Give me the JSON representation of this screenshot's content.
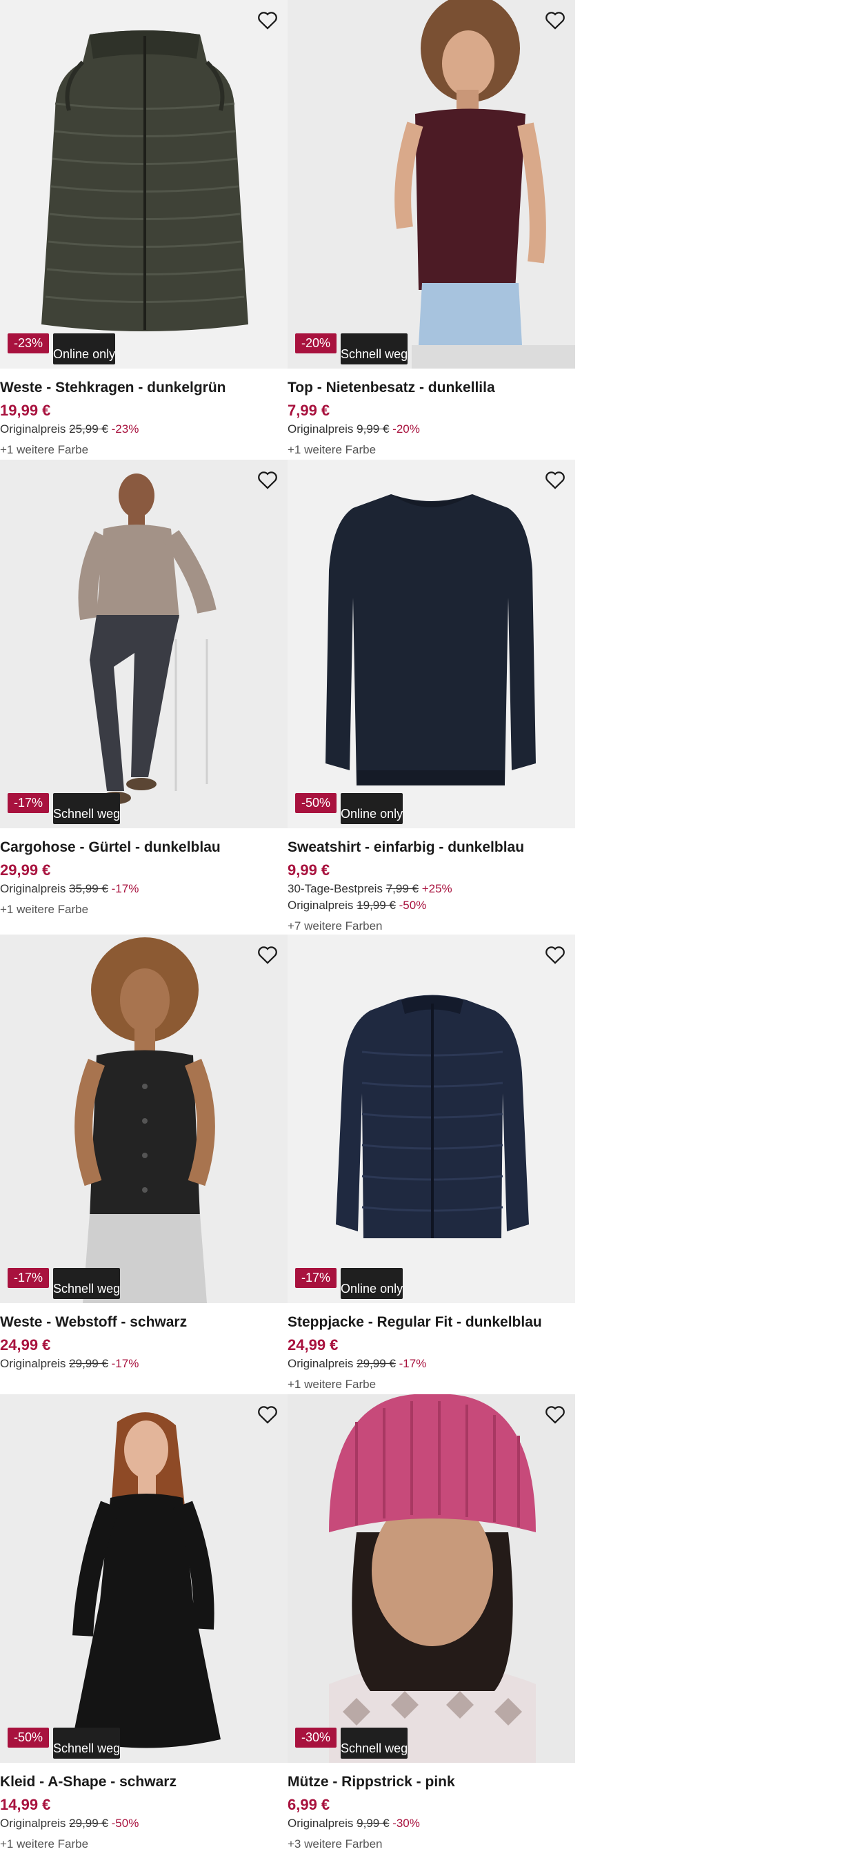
{
  "products": [
    {
      "name": "Weste - Stehkragen - dunkelgrün",
      "price": "19,99 €",
      "discount": "-23%",
      "tag": "Online only",
      "lines": [
        {
          "label": "Originalpreis",
          "old": "25,99 €",
          "pct": "-23%"
        }
      ],
      "colors": "+1 weitere Farbe"
    },
    {
      "name": "Top - Nietenbesatz - dunkellila",
      "price": "7,99 €",
      "discount": "-20%",
      "tag": "Schnell weg",
      "lines": [
        {
          "label": "Originalpreis",
          "old": "9,99 €",
          "pct": "-20%"
        }
      ],
      "colors": "+1 weitere Farbe"
    },
    {
      "name": "Cargohose - Gürtel - dunkelblau",
      "price": "29,99 €",
      "discount": "-17%",
      "tag": "Schnell weg",
      "lines": [
        {
          "label": "Originalpreis",
          "old": "35,99 €",
          "pct": "-17%"
        }
      ],
      "colors": "+1 weitere Farbe"
    },
    {
      "name": "Sweatshirt - einfarbig - dunkelblau",
      "price": "9,99 €",
      "discount": "-50%",
      "tag": "Online only",
      "lines": [
        {
          "label": "30-Tage-Bestpreis",
          "old": "7,99 €",
          "pct": "+25%"
        },
        {
          "label": "Originalpreis",
          "old": "19,99 €",
          "pct": "-50%"
        }
      ],
      "colors": "+7 weitere Farben"
    },
    {
      "name": "Weste - Webstoff - schwarz",
      "price": "24,99 €",
      "discount": "-17%",
      "tag": "Schnell weg",
      "lines": [
        {
          "label": "Originalpreis",
          "old": "29,99 €",
          "pct": "-17%"
        }
      ],
      "colors": ""
    },
    {
      "name": "Steppjacke - Regular Fit - dunkelblau",
      "price": "24,99 €",
      "discount": "-17%",
      "tag": "Online only",
      "lines": [
        {
          "label": "Originalpreis",
          "old": "29,99 €",
          "pct": "-17%"
        }
      ],
      "colors": "+1 weitere Farbe"
    },
    {
      "name": "Kleid - A-Shape - schwarz",
      "price": "14,99 €",
      "discount": "-50%",
      "tag": "Schnell weg",
      "lines": [
        {
          "label": "Originalpreis",
          "old": "29,99 €",
          "pct": "-50%"
        }
      ],
      "colors": "+1 weitere Farbe"
    },
    {
      "name": "Mütze - Rippstrick - pink",
      "price": "6,99 €",
      "discount": "-30%",
      "tag": "Schnell weg",
      "lines": [
        {
          "label": "Originalpreis",
          "old": "9,99 €",
          "pct": "-30%"
        }
      ],
      "colors": "+3 weitere Farben"
    }
  ],
  "colors": {
    "accent": "#a8123e",
    "tag_bg": "#1f1f1f",
    "image_bg": "#f1f1f1"
  },
  "icons": {
    "favorite": "heart-outline-icon"
  }
}
